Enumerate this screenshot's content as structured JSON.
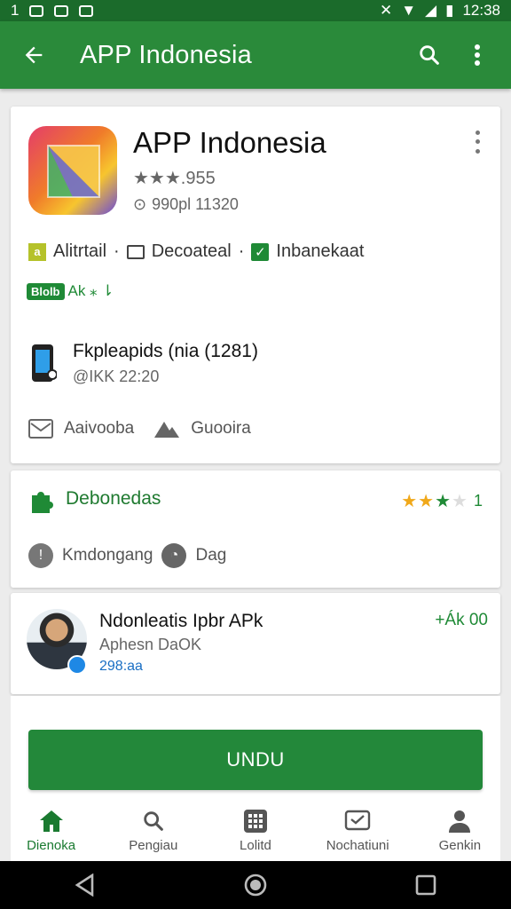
{
  "status_bar": {
    "left_text": "1",
    "time": "12:38"
  },
  "toolbar": {
    "title": "APP Indonesia"
  },
  "app": {
    "name": "APP Indonesia",
    "rating_text": "★★★.955",
    "sub_text": "990pl 11320",
    "tags": [
      "Alitrtail",
      "Decoateal",
      "Inbanekaat"
    ],
    "badge_label": "Blolb",
    "badge_text": "Ak ⁎ ⇂"
  },
  "device": {
    "title": "Fkpleapids (nia (1281)",
    "sub": "@IKK 22:20"
  },
  "actions": {
    "first": "Aaivooba",
    "second": "Guooira"
  },
  "downloads": {
    "title": "Debonedas",
    "rating_number": "1",
    "chip_1": "Kmdongang",
    "chip_2": "Dag"
  },
  "developer": {
    "name": "Ndonleatis Ipbr APk",
    "sub": "Aphesn DaOK",
    "count": "298:aa",
    "right": "+Ák 00"
  },
  "install": {
    "label": "UNDU"
  },
  "bottom_nav": [
    "Dienoka",
    "Pengiau",
    "Lolitd",
    "Nochatiuni",
    "Genkin"
  ],
  "colors": {
    "primary": "#2a8a3a",
    "status_bar": "#1b6b2b",
    "accent_star": "#f0a81a",
    "link": "#1a6fc4"
  }
}
